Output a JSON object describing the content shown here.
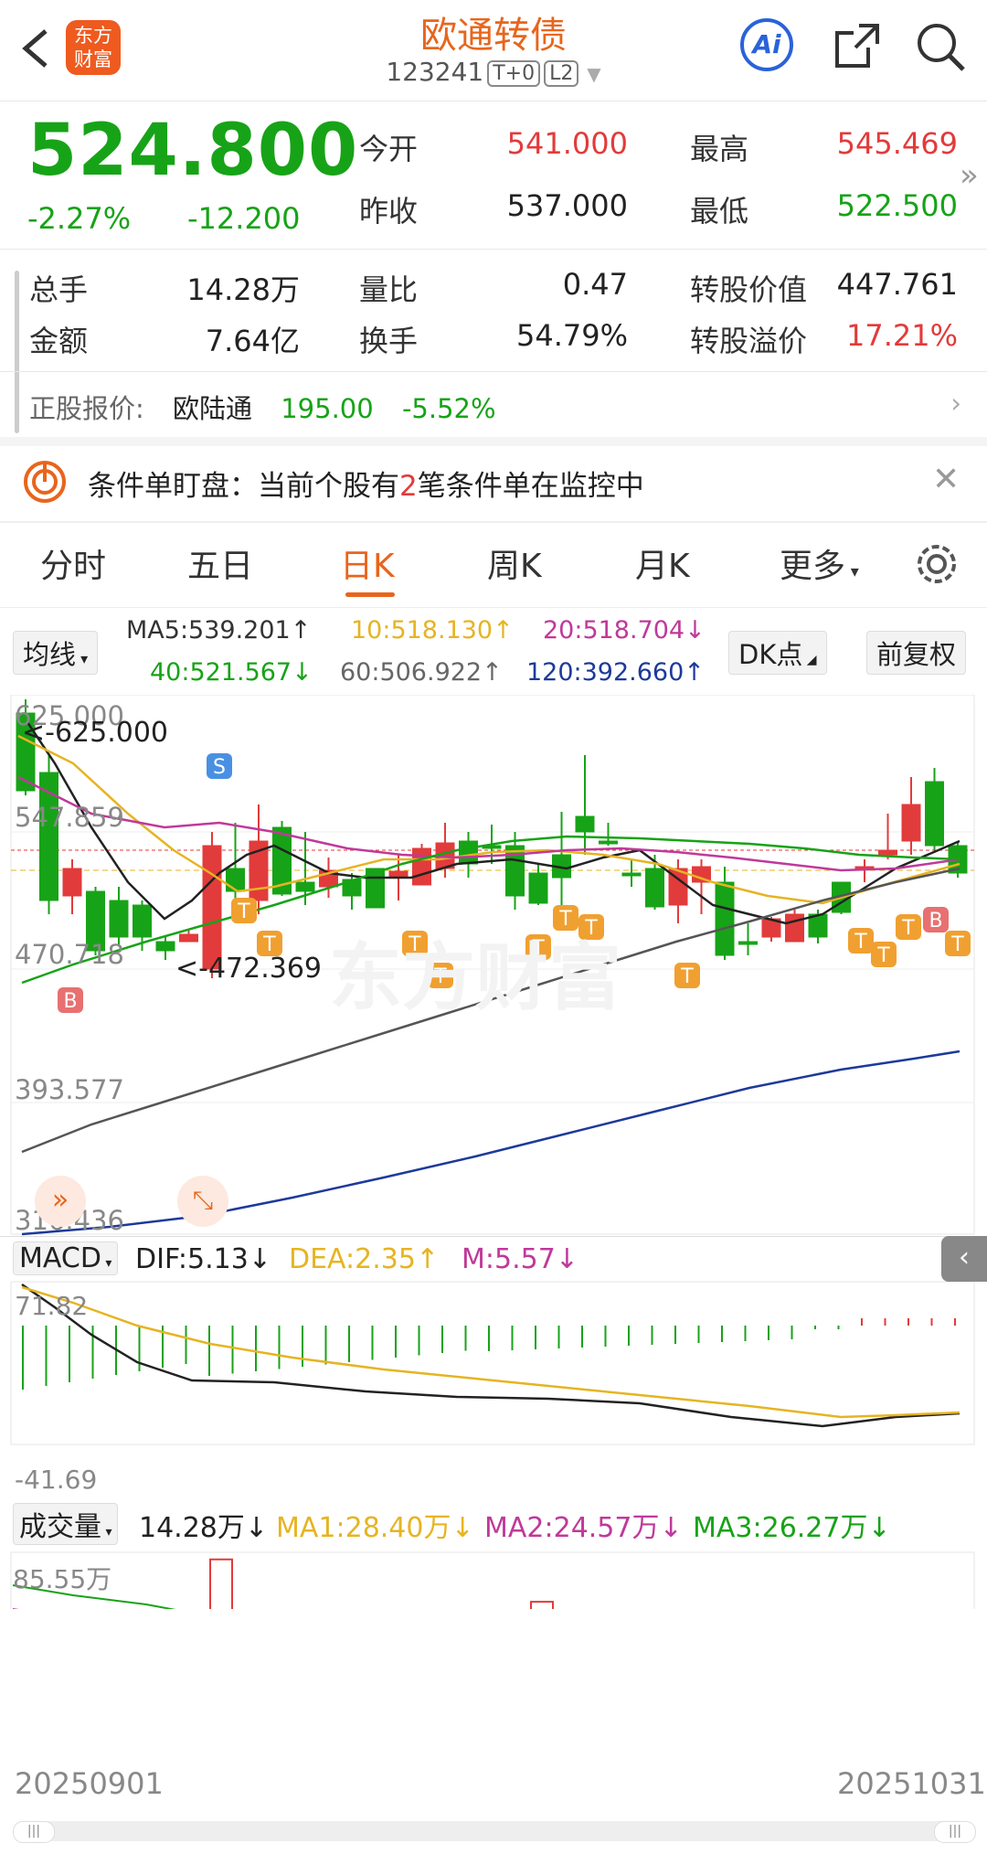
{
  "header": {
    "title": "欧通转债",
    "code": "123241",
    "tag1": "T+0",
    "tag2": "L2",
    "logo": "东方财富",
    "ai": "Ai"
  },
  "quote": {
    "price": "524.800",
    "pct": "-2.27%",
    "chg": "-12.200",
    "open_label": "今开",
    "open": "541.000",
    "high_label": "最高",
    "high": "545.469",
    "prevclose_label": "昨收",
    "prevclose": "537.000",
    "low_label": "最低",
    "low": "522.500",
    "vol_label": "总手",
    "vol": "14.28万",
    "ratio_label": "量比",
    "ratio": "0.47",
    "conv_value_label": "转股价值",
    "conv_value": "447.761",
    "amt_label": "金额",
    "amt": "7.64亿",
    "turnover_label": "换手",
    "turnover": "54.79%",
    "premium_label": "转股溢价",
    "premium": "17.21%",
    "stock_label": "正股报价:",
    "stock_name": "欧陆通",
    "stock_price": "195.00",
    "stock_pct": "-5.52%"
  },
  "alert": {
    "prefix": "条件单盯盘：当前个股有",
    "count": "2",
    "suffix": "笔条件单在监控中"
  },
  "tabs": [
    "分时",
    "五日",
    "日K",
    "周K",
    "月K",
    "更多"
  ],
  "active_tab": "日K",
  "ma": {
    "selector": "均线",
    "ma5": "MA5:539.201↑",
    "ma10": "10:518.130↑",
    "ma20": "20:518.704↓",
    "ma40": "40:521.567↓",
    "ma60": "60:506.922↑",
    "ma120": "120:392.660↑",
    "dk": "DK点",
    "adj": "前复权"
  },
  "kline": {
    "y_labels": [
      "625.000",
      "547.859",
      "470.718",
      "393.577",
      "316.436"
    ],
    "high_mark": "<-625.000",
    "low_mark": "<-472.369",
    "watermark": "东方财富"
  },
  "macd": {
    "selector": "MACD",
    "dif": "DIF:5.13↓",
    "dea": "DEA:2.35↑",
    "m": "M:5.57↓",
    "ymax": "71.82",
    "ymin": "-41.69"
  },
  "volume": {
    "selector": "成交量",
    "value": "14.28万↓",
    "ma1": "MA1:28.40万↓",
    "ma2": "MA2:24.57万↓",
    "ma3": "MA3:26.27万↓",
    "ymax": "85.55万"
  },
  "dates": {
    "start": "20250901",
    "end": "20251031"
  },
  "colors": {
    "up": "#e23b3b",
    "down": "#17a317",
    "accent": "#e8651c"
  }
}
